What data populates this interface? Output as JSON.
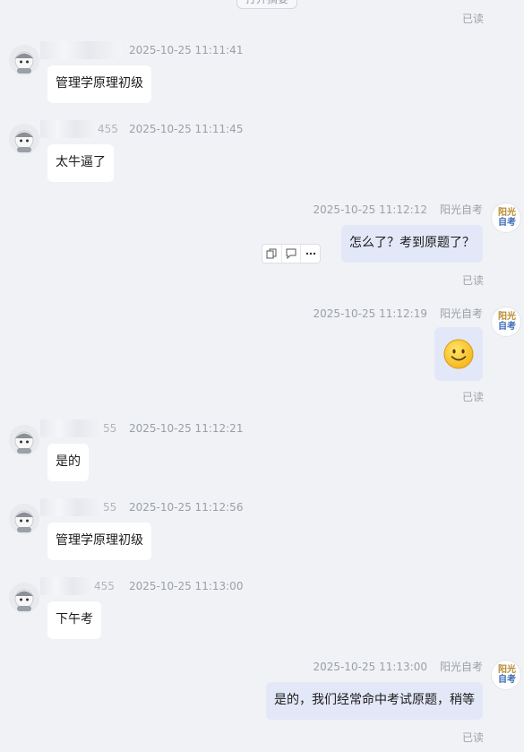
{
  "top_button": {
    "label": "打开摘要"
  },
  "read_label": "已读",
  "brand": {
    "line1": "阳光",
    "line2": "自考"
  },
  "messages": [
    {
      "side": "in",
      "name_tail": "",
      "time": "2025-10-25 11:11:41",
      "text": "管理学原理初级"
    },
    {
      "side": "in",
      "name_tail": "455",
      "time": "2025-10-25 11:11:45",
      "text": "太牛逼了"
    },
    {
      "side": "out",
      "sender": "阳光自考",
      "time": "2025-10-25 11:12:12",
      "text": "怎么了？考到原题了？"
    },
    {
      "side": "out",
      "sender": "阳光自考",
      "time": "2025-10-25 11:12:19",
      "emoji": "smile-emoji"
    },
    {
      "side": "in",
      "name_tail": "55",
      "time": "2025-10-25 11:12:21",
      "text": "是的"
    },
    {
      "side": "in",
      "name_tail": "55",
      "time": "2025-10-25 11:12:56",
      "text": "管理学原理初级"
    },
    {
      "side": "in",
      "name_tail": "455",
      "time": "2025-10-25 11:13:00",
      "text": "下午考"
    },
    {
      "side": "out",
      "sender": "阳光自考",
      "time": "2025-10-25 11:13:00",
      "text": "是的，我们经常命中考试原题，稍等"
    }
  ],
  "message_actions": [
    "copy-icon",
    "quote-icon",
    "more-icon"
  ],
  "colors": {
    "background": "#f1f2f6",
    "incoming_bubble": "#ffffff",
    "outgoing_bubble": "#e3e8f8",
    "meta_text": "#9aa0a8"
  }
}
